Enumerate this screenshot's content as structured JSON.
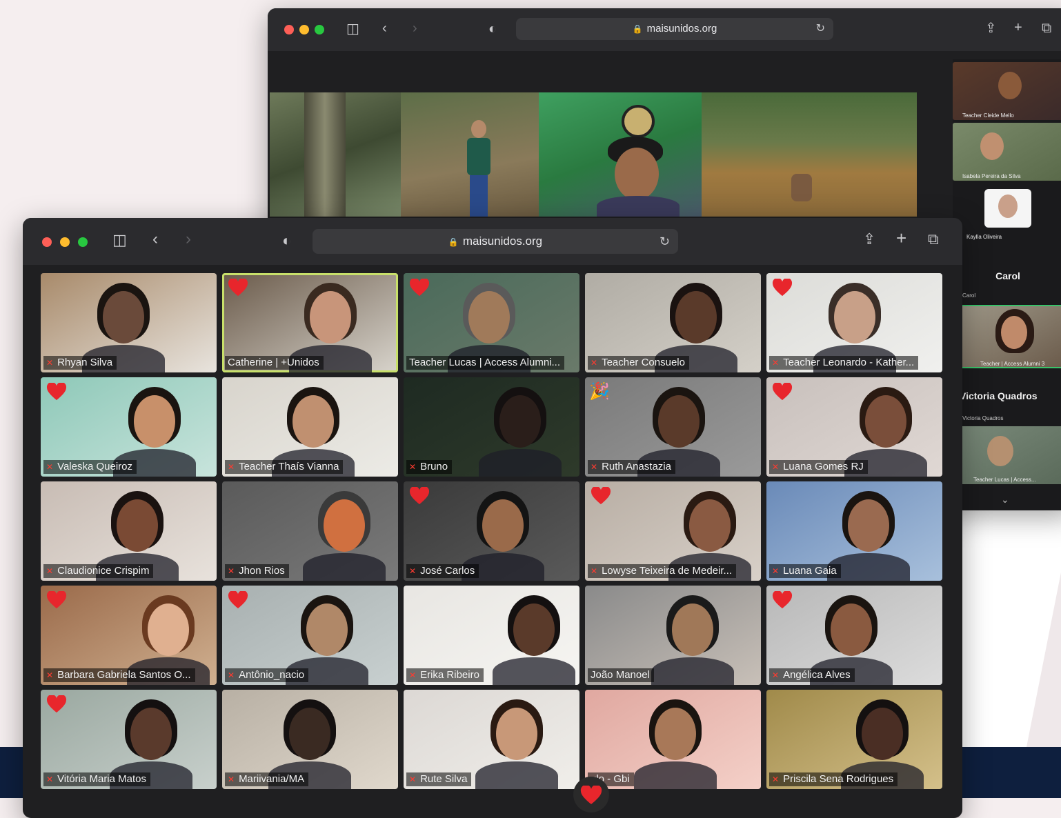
{
  "colors": {
    "mic_muted": "#ff3b30",
    "active_speaker": "#c8e06a",
    "reaction_heart": "#e8262c",
    "footer_band": "#0e1f3e"
  },
  "back_window": {
    "url": "maisunidos.org",
    "side_panel": [
      {
        "label": "Teacher Cleide Mello"
      },
      {
        "label": "Isabela Pereira da Silva"
      },
      {
        "label": "Kaylla Oliveira"
      },
      {
        "name": "Carol",
        "label": "Carol"
      },
      {
        "label": "Teacher | Access Alumni 3"
      },
      {
        "name": "Victoria Quadros",
        "label": "Victoria Quadros"
      },
      {
        "label": "Teacher Lucas | Access..."
      }
    ]
  },
  "front_window": {
    "url": "maisunidos.org",
    "participants": [
      {
        "name": "Rhyan Silva",
        "muted": true,
        "reaction": ""
      },
      {
        "name": "Catherine | +Unidos",
        "muted": false,
        "reaction": "heart",
        "active": true
      },
      {
        "name": "Teacher Lucas | Access Alumni...",
        "muted": false,
        "reaction": "heart"
      },
      {
        "name": "Teacher Consuelo",
        "muted": true,
        "reaction": ""
      },
      {
        "name": "Teacher Leonardo - Kather...",
        "muted": true,
        "reaction": "heart"
      },
      {
        "name": "Valeska Queiroz",
        "muted": true,
        "reaction": "heart"
      },
      {
        "name": "Teacher Thaís Vianna",
        "muted": true,
        "reaction": ""
      },
      {
        "name": "Bruno",
        "muted": true,
        "reaction": ""
      },
      {
        "name": "Ruth Anastazia",
        "muted": true,
        "reaction": "party"
      },
      {
        "name": "Luana Gomes RJ",
        "muted": true,
        "reaction": "heart"
      },
      {
        "name": "Claudionice Crispim",
        "muted": true,
        "reaction": ""
      },
      {
        "name": "Jhon Rios",
        "muted": true,
        "reaction": ""
      },
      {
        "name": "José Carlos",
        "muted": true,
        "reaction": "heart"
      },
      {
        "name": "Lowyse Teixeira de Medeir...",
        "muted": true,
        "reaction": "heart"
      },
      {
        "name": "Luana Gaia",
        "muted": true,
        "reaction": ""
      },
      {
        "name": "Barbara Gabriela Santos O...",
        "muted": true,
        "reaction": "heart"
      },
      {
        "name": "Antônio_nacio",
        "muted": true,
        "reaction": "heart"
      },
      {
        "name": "Erika Ribeiro",
        "muted": true,
        "reaction": ""
      },
      {
        "name": "João Manoel",
        "muted": false,
        "reaction": ""
      },
      {
        "name": "Angélica Alves",
        "muted": true,
        "reaction": "heart"
      },
      {
        "name": "Vitória Maria Matos",
        "muted": true,
        "reaction": "heart"
      },
      {
        "name": "Mariivania/MA",
        "muted": true,
        "reaction": ""
      },
      {
        "name": "Rute Silva",
        "muted": true,
        "reaction": ""
      },
      {
        "name": "ulo - Gbi",
        "muted": false,
        "reaction": ""
      },
      {
        "name": "Priscila Sena Rodrigues",
        "muted": true,
        "reaction": ""
      }
    ]
  }
}
